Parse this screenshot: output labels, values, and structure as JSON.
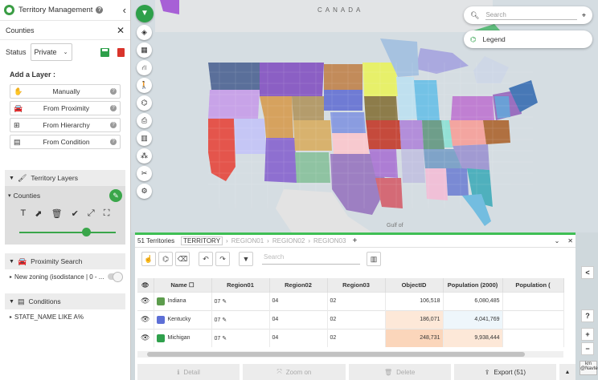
{
  "app": {
    "title": "Territory Management"
  },
  "panel": {
    "section_title": "Counties",
    "status_label": "Status",
    "status_value": "Private",
    "add_layer_label": "Add a Layer :",
    "add_buttons": [
      {
        "label": "Manually",
        "icon": "hand-icon"
      },
      {
        "label": "From Proximity",
        "icon": "car-icon"
      },
      {
        "label": "From Hierarchy",
        "icon": "hierarchy-icon"
      },
      {
        "label": "From Condition",
        "icon": "condition-icon"
      }
    ],
    "territory_layers_label": "Territory Layers",
    "counties_sub_label": "Counties",
    "proximity_label": "Proximity Search",
    "proximity_item": "New zoning (isodistance | 0 - ...",
    "conditions_label": "Conditions",
    "condition_item": "STATE_NAME LIKE A%",
    "opacity": 0.72
  },
  "map": {
    "country_label": "CANADA",
    "gulf_label": "Gulf of",
    "search_placeholder": "Search",
    "legend_label": "Legend"
  },
  "grid": {
    "count_label": "51 Territories",
    "tabs": [
      "TERRITORY",
      "REGION01",
      "REGION02",
      "REGION03"
    ],
    "search_placeholder": "Search",
    "columns": [
      "Name",
      "Region01",
      "Region02",
      "Region03",
      "ObjectID",
      "Population (2000)",
      "Population ("
    ],
    "rows": [
      {
        "name": "Indiana",
        "color": "#5c9c4c",
        "r1": "07",
        "r2": "04",
        "r3": "02",
        "oid": "106,518",
        "pop": "6,080,485",
        "oid_bg": "#ffffff",
        "pop_bg": "#ffffff"
      },
      {
        "name": "Kentucky",
        "color": "#5d6fd6",
        "r1": "07",
        "r2": "04",
        "r3": "02",
        "oid": "186,071",
        "pop": "4,041,769",
        "oid_bg": "#fde8d8",
        "pop_bg": "#eef6fb"
      },
      {
        "name": "Michigan",
        "color": "#2fa04c",
        "r1": "07",
        "r2": "04",
        "r3": "02",
        "oid": "248,731",
        "pop": "9,938,444",
        "oid_bg": "#fbd6bb",
        "pop_bg": "#fde8d8"
      }
    ],
    "actions": {
      "detail": "Detail",
      "zoom": "Zoom on",
      "delete": "Delete",
      "export": "Export (51)"
    }
  },
  "map_controls": {
    "share": "<",
    "help": "?",
    "zoom_in": "+",
    "zoom_out": "−",
    "scale_unit": "km",
    "credit": "@Navteq"
  }
}
